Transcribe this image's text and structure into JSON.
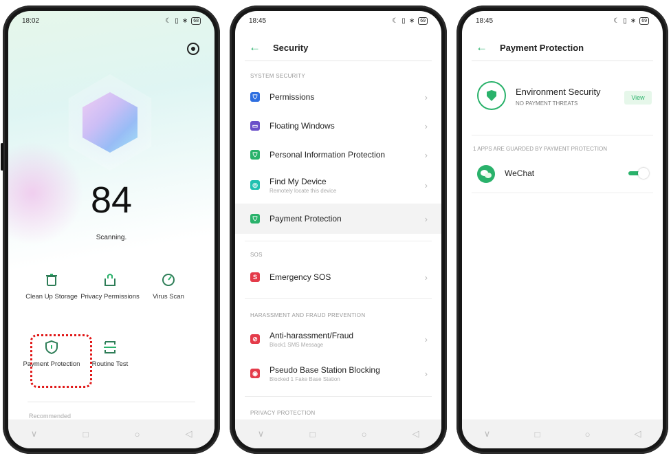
{
  "phone1": {
    "status_time": "18:02",
    "battery": "68",
    "score": "84",
    "scanning": "Scanning.",
    "tools": [
      {
        "label": "Clean Up Storage",
        "icon": "trash-icon"
      },
      {
        "label": "Privacy Permissions",
        "icon": "privacy-icon"
      },
      {
        "label": "Virus Scan",
        "icon": "virus-scan-icon"
      },
      {
        "label": "Payment Protection",
        "icon": "shield-icon"
      },
      {
        "label": "Routine Test",
        "icon": "routine-test-icon"
      }
    ],
    "recommended": "Recommended"
  },
  "phone2": {
    "status_time": "18:45",
    "battery": "69",
    "title": "Security",
    "sections": [
      {
        "title": "SYSTEM SECURITY"
      },
      {
        "title": "SOS"
      },
      {
        "title": "HARASSMENT AND FRAUD PREVENTION"
      },
      {
        "title": "PRIVACY PROTECTION"
      }
    ],
    "items": [
      {
        "label": "Permissions",
        "sub": "",
        "color": "#2f6fe0",
        "glyph": "⛉"
      },
      {
        "label": "Floating Windows",
        "sub": "",
        "color": "#6a4fc9",
        "glyph": "▭"
      },
      {
        "label": "Personal Information Protection",
        "sub": "",
        "color": "#2ab26b",
        "glyph": "⛉"
      },
      {
        "label": "Find My Device",
        "sub": "Remotely locate this device",
        "color": "#20c0b0",
        "glyph": "◎"
      },
      {
        "label": "Payment Protection",
        "sub": "",
        "color": "#2ab26b",
        "glyph": "⛉"
      },
      {
        "label": "Emergency SOS",
        "sub": "",
        "color": "#e43b4a",
        "glyph": "S"
      },
      {
        "label": "Anti-harassment/Fraud",
        "sub": "Block1 SMS Message",
        "color": "#e43b4a",
        "glyph": "⊘"
      },
      {
        "label": "Pseudo Base Station Blocking",
        "sub": "Blocked 1 Fake Base Station",
        "color": "#e43b4a",
        "glyph": "◉"
      }
    ]
  },
  "phone3": {
    "status_time": "18:45",
    "battery": "69",
    "title": "Payment Protection",
    "env_title": "Environment Security",
    "env_sub": "NO PAYMENT THREATS",
    "view": "View",
    "guard_head": "1 APPS ARE GUARDED BY PAYMENT PROTECTION",
    "app_name": "WeChat",
    "app_toggle_on": true
  },
  "nav": {
    "back": "∨",
    "recents": "□",
    "home": "○",
    "prev": "◁"
  },
  "colors": {
    "accent": "#2ab26b",
    "highlight": "#e01818"
  }
}
